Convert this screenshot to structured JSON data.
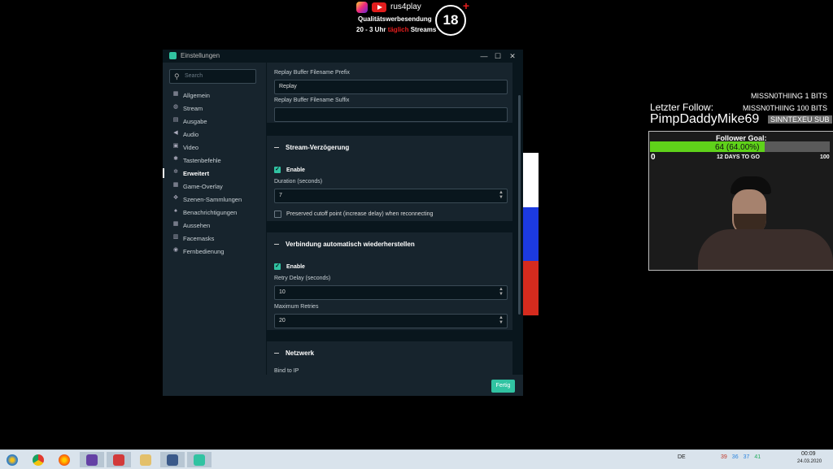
{
  "banner": {
    "handle": "rus4play",
    "line1": "Qualitätswerbesendung",
    "line2_a": "20 - 3 Uhr ",
    "line2_b": "täglich",
    "line2_c": " Streams",
    "badge": "18",
    "badge_plus": "+"
  },
  "window": {
    "title": "Einstellungen",
    "controls": {
      "minimize": "—",
      "maximize": "☐",
      "close": "✕"
    }
  },
  "sidebar": {
    "search_placeholder": "Search",
    "items": [
      {
        "label": "Allgemein",
        "icon": "grid-icon",
        "glyph": "▦"
      },
      {
        "label": "Stream",
        "icon": "globe-icon",
        "glyph": "◍"
      },
      {
        "label": "Ausgabe",
        "icon": "database-icon",
        "glyph": "▤"
      },
      {
        "label": "Audio",
        "icon": "speaker-icon",
        "glyph": "◀"
      },
      {
        "label": "Video",
        "icon": "film-icon",
        "glyph": "▣"
      },
      {
        "label": "Tastenbefehle",
        "icon": "gear-icon",
        "glyph": "✱"
      },
      {
        "label": "Erweitert",
        "icon": "gears-icon",
        "glyph": "✲",
        "active": true
      },
      {
        "label": "Game-Overlay",
        "icon": "overlay-icon",
        "glyph": "▦"
      },
      {
        "label": "Szenen-Sammlungen",
        "icon": "collection-icon",
        "glyph": "✥"
      },
      {
        "label": "Benachrichtigungen",
        "icon": "bell-icon",
        "glyph": "♠"
      },
      {
        "label": "Aussehen",
        "icon": "appearance-icon",
        "glyph": "▦"
      },
      {
        "label": "Facemasks",
        "icon": "mask-icon",
        "glyph": "▥"
      },
      {
        "label": "Fernbedienung",
        "icon": "remote-icon",
        "glyph": "◉"
      }
    ]
  },
  "replay": {
    "prefix_label": "Replay Buffer Filename Prefix",
    "prefix_value": "Replay",
    "suffix_label": "Replay Buffer Filename Suffix",
    "suffix_value": ""
  },
  "stream_delay": {
    "title": "Stream-Verzögerung",
    "enable_label": "Enable",
    "duration_label": "Duration (seconds)",
    "duration_value": "7",
    "preserve_label": "Preserved cutoff point (increase delay) when reconnecting"
  },
  "reconnect": {
    "title": "Verbindung automatisch wiederherstellen",
    "enable_label": "Enable",
    "retry_delay_label": "Retry Delay (seconds)",
    "retry_delay_value": "10",
    "max_retries_label": "Maximum Retries",
    "max_retries_value": "20"
  },
  "network": {
    "title": "Netzwerk",
    "bind_label": "Bind to IP"
  },
  "footer": {
    "done_label": "Fertig"
  },
  "overlay": {
    "top_bits": "MISSN0THIING   1 BITS",
    "last_follow_label": "Letzter Follow:",
    "last_follow_bits": "MISSN0THIING   100 BITS",
    "follower_name": "PimpDaddyMike69",
    "sub_tag": "SINNTEXEU   SUB",
    "goal_title": "Follower Goal:",
    "goal_value": "64 (64.00%)",
    "goal_fraction": 0.64,
    "goal_min": "0",
    "goal_max": "100",
    "days_left": "12 DAYS TO GO"
  },
  "taskbar": {
    "lang": "DE",
    "tray_numbers": [
      "39",
      "36",
      "37",
      "41"
    ],
    "time": "00:09",
    "date": "24.03.2020"
  },
  "colors": {
    "accent": "#31c3a2",
    "window_bg": "#17242d",
    "content_bg": "#09161d",
    "goal_fill": "#5fd21a"
  }
}
